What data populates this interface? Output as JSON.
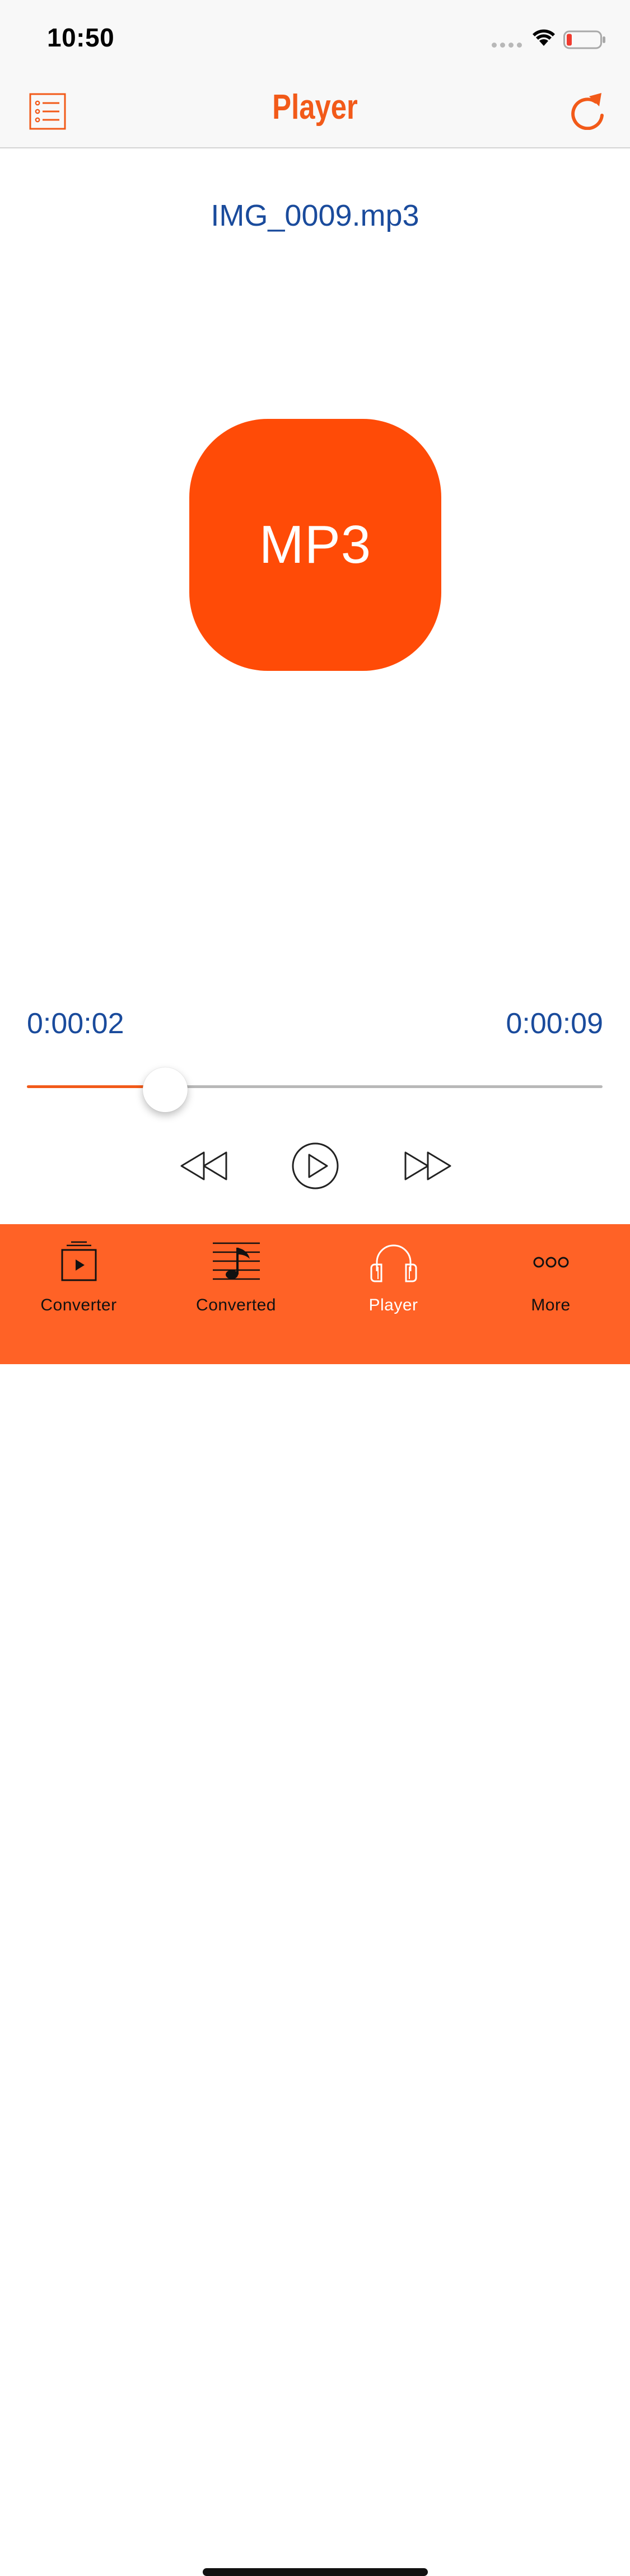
{
  "status_bar": {
    "time": "10:50",
    "battery_color": "#f03b2f"
  },
  "nav": {
    "title": "Player",
    "list_icon": "list-icon",
    "refresh_icon": "refresh-icon"
  },
  "player": {
    "file_name": "IMG_0009.mp3",
    "artwork_label": "MP3",
    "elapsed": "0:00:02",
    "total": "0:00:09",
    "progress_fraction": 0.24
  },
  "controls": {
    "rewind_icon": "rewind-icon",
    "play_icon": "play-icon",
    "forward_icon": "fast-forward-icon"
  },
  "tab_bar": {
    "tabs": [
      {
        "label": "Converter",
        "icon": "video-converter-icon",
        "active": false
      },
      {
        "label": "Converted",
        "icon": "music-note-icon",
        "active": false
      },
      {
        "label": "Player",
        "icon": "headphones-icon",
        "active": true
      },
      {
        "label": "More",
        "icon": "more-icon",
        "active": false
      }
    ]
  },
  "colors": {
    "accent": "#f25a19",
    "artwork": "#ff4b07",
    "tab_bar": "#ff6226",
    "text_blue": "#1a4b9c"
  }
}
